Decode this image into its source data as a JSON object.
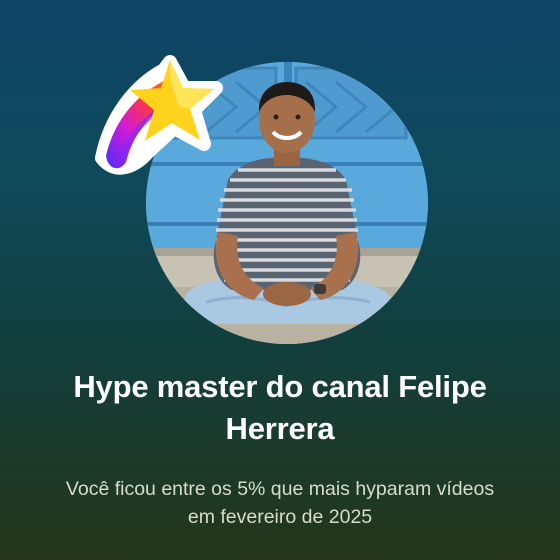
{
  "card": {
    "title": "Hype master do canal Felipe Herrera",
    "subtitle": "Você ficou entre os 5% que mais hyparam vídeos em fevereiro de 2025"
  },
  "icons": {
    "sticker": "shooting-star-icon"
  },
  "colors": {
    "background_top": "#0e4466",
    "background_bottom": "#24351a",
    "title_text": "#ffffff",
    "subtitle_text": "#d7dccb",
    "star_yellow": "#ffd21c"
  }
}
